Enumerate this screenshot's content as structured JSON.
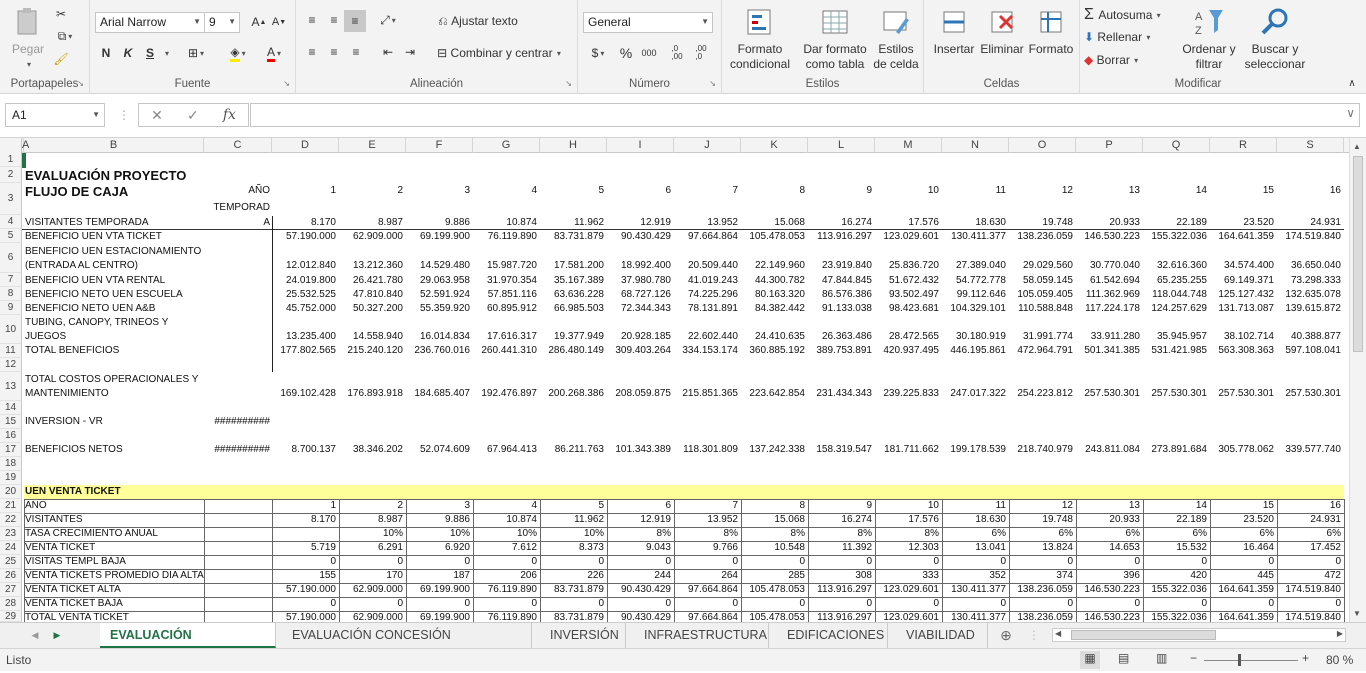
{
  "ribbon": {
    "portapapeles": {
      "label": "Portapapeles",
      "paste": "Pegar"
    },
    "fuente": {
      "label": "Fuente",
      "font": "Arial Narrow",
      "size": "9",
      "bold": "N",
      "italic": "K",
      "underline": "S"
    },
    "alineacion": {
      "label": "Alineación",
      "wrap": "Ajustar texto",
      "merge": "Combinar y centrar"
    },
    "numero": {
      "label": "Número",
      "format": "General",
      "currency": "$",
      "percent": "%",
      "thousands": "000",
      "inc_dec": ",0\n,00",
      "dec_dec": ",00\n,0"
    },
    "estilos": {
      "label": "Estilos",
      "cond": "Formato condicional",
      "table": "Dar formato como tabla",
      "cell": "Estilos de celda"
    },
    "celdas": {
      "label": "Celdas",
      "insert": "Insertar",
      "delete": "Eliminar",
      "format": "Formato"
    },
    "modificar": {
      "label": "Modificar",
      "autosum": "Autosuma",
      "fill": "Rellenar",
      "clear": "Borrar",
      "sort": "Ordenar y filtrar",
      "find": "Buscar y seleccionar"
    }
  },
  "formula_bar": {
    "namebox": "A1",
    "fx": "fx",
    "value": ""
  },
  "columns": [
    "A",
    "B",
    "C",
    "D",
    "E",
    "F",
    "G",
    "H",
    "I",
    "J",
    "K",
    "L",
    "M",
    "N",
    "O",
    "P",
    "Q",
    "R",
    "S"
  ],
  "rows": [
    "1",
    "2",
    "3",
    "4",
    "5",
    "6",
    "7",
    "8",
    "9",
    "10",
    "11",
    "12",
    "13",
    "14",
    "15",
    "16",
    "17",
    "18",
    "19",
    "20",
    "21",
    "22",
    "23",
    "24",
    "25",
    "26",
    "27",
    "28",
    "29"
  ],
  "cells": {
    "r2": {
      "b": "EVALUACIÓN PROYECTO"
    },
    "r3": {
      "b": "FLUJO DE CAJA",
      "c": "AÑO",
      "vals": [
        "1",
        "2",
        "3",
        "4",
        "5",
        "6",
        "7",
        "8",
        "9",
        "10",
        "11",
        "12",
        "13",
        "14",
        "15",
        "16"
      ]
    },
    "r3b": {
      "c": "TEMPORAD"
    },
    "r4": {
      "b": "VISITANTES TEMPORADA",
      "c": "A",
      "vals": [
        "8.170",
        "8.987",
        "9.886",
        "10.874",
        "11.962",
        "12.919",
        "13.952",
        "15.068",
        "16.274",
        "17.576",
        "18.630",
        "19.748",
        "20.933",
        "22.189",
        "23.520",
        "24.931"
      ]
    },
    "r5": {
      "b": "BENEFICIO UEN VTA TICKET",
      "vals": [
        "57.190.000",
        "62.909.000",
        "69.199.900",
        "76.119.890",
        "83.731.879",
        "90.430.429",
        "97.664.864",
        "105.478.053",
        "113.916.297",
        "123.029.601",
        "130.411.377",
        "138.236.059",
        "146.530.223",
        "155.322.036",
        "164.641.359",
        "174.519.840"
      ]
    },
    "r6a": {
      "b": "BENEFICIO UEN ESTACIONAMIENTO"
    },
    "r6": {
      "b": "(ENTRADA AL CENTRO)",
      "vals": [
        "12.012.840",
        "13.212.360",
        "14.529.480",
        "15.987.720",
        "17.581.200",
        "18.992.400",
        "20.509.440",
        "22.149.960",
        "23.919.840",
        "25.836.720",
        "27.389.040",
        "29.029.560",
        "30.770.040",
        "32.616.360",
        "34.574.400",
        "36.650.040"
      ]
    },
    "r7": {
      "b": "BENEFICIO UEN VTA RENTAL",
      "vals": [
        "24.019.800",
        "26.421.780",
        "29.063.958",
        "31.970.354",
        "35.167.389",
        "37.980.780",
        "41.019.243",
        "44.300.782",
        "47.844.845",
        "51.672.432",
        "54.772.778",
        "58.059.145",
        "61.542.694",
        "65.235.255",
        "69.149.371",
        "73.298.333"
      ]
    },
    "r8": {
      "b": "BENEFICIO NETO UEN ESCUELA",
      "vals": [
        "25.532.525",
        "47.810.840",
        "52.591.924",
        "57.851.116",
        "63.636.228",
        "68.727.126",
        "74.225.296",
        "80.163.320",
        "86.576.386",
        "93.502.497",
        "99.112.646",
        "105.059.405",
        "111.362.969",
        "118.044.748",
        "125.127.432",
        "132.635.078"
      ]
    },
    "r9": {
      "b": "BENEFICIO NETO UEN A&B",
      "vals": [
        "45.752.000",
        "50.327.200",
        "55.359.920",
        "60.895.912",
        "66.985.503",
        "72.344.343",
        "78.131.891",
        "84.382.442",
        "91.133.038",
        "98.423.681",
        "104.329.101",
        "110.588.848",
        "117.224.178",
        "124.257.629",
        "131.713.087",
        "139.615.872"
      ]
    },
    "r10a": {
      "b": "TUBING, CANOPY, TRINEOS Y"
    },
    "r10": {
      "b": "JUEGOS",
      "vals": [
        "13.235.400",
        "14.558.940",
        "16.014.834",
        "17.616.317",
        "19.377.949",
        "20.928.185",
        "22.602.440",
        "24.410.635",
        "26.363.486",
        "28.472.565",
        "30.180.919",
        "31.991.774",
        "33.911.280",
        "35.945.957",
        "38.102.714",
        "40.388.877"
      ]
    },
    "r11": {
      "b": "TOTAL BENEFICIOS",
      "vals": [
        "177.802.565",
        "215.240.120",
        "236.760.016",
        "260.441.310",
        "286.480.149",
        "309.403.264",
        "334.153.174",
        "360.885.192",
        "389.753.891",
        "420.937.495",
        "446.195.861",
        "472.964.791",
        "501.341.385",
        "531.421.985",
        "563.308.363",
        "597.108.041"
      ]
    },
    "r13a": {
      "b": "TOTAL COSTOS OPERACIONALES Y"
    },
    "r13": {
      "b": "MANTENIMIENTO",
      "vals": [
        "169.102.428",
        "176.893.918",
        "184.685.407",
        "192.476.897",
        "200.268.386",
        "208.059.875",
        "215.851.365",
        "223.642.854",
        "231.434.343",
        "239.225.833",
        "247.017.322",
        "254.223.812",
        "257.530.301",
        "257.530.301",
        "257.530.301",
        "257.530.301"
      ]
    },
    "r15": {
      "b": "INVERSION - VR",
      "c": "##########"
    },
    "r17": {
      "b": "BENEFICIOS NETOS",
      "c": "##########",
      "vals": [
        "8.700.137",
        "38.346.202",
        "52.074.609",
        "67.964.413",
        "86.211.763",
        "101.343.389",
        "118.301.809",
        "137.242.338",
        "158.319.547",
        "181.711.662",
        "199.178.539",
        "218.740.979",
        "243.811.084",
        "273.891.684",
        "305.778.062",
        "339.577.740"
      ]
    },
    "r20": {
      "b": "UEN VENTA TICKET"
    },
    "r21": {
      "b": "AÑO",
      "vals": [
        "1",
        "2",
        "3",
        "4",
        "5",
        "6",
        "7",
        "8",
        "9",
        "10",
        "11",
        "12",
        "13",
        "14",
        "15",
        "16"
      ]
    },
    "r22": {
      "b": "VISITANTES",
      "vals": [
        "8.170",
        "8.987",
        "9.886",
        "10.874",
        "11.962",
        "12.919",
        "13.952",
        "15.068",
        "16.274",
        "17.576",
        "18.630",
        "19.748",
        "20.933",
        "22.189",
        "23.520",
        "24.931"
      ]
    },
    "r23": {
      "b": "TASA CRECIMIENTO ANUAL",
      "vals": [
        "",
        "10%",
        "10%",
        "10%",
        "10%",
        "8%",
        "8%",
        "8%",
        "8%",
        "8%",
        "6%",
        "6%",
        "6%",
        "6%",
        "6%",
        "6%"
      ]
    },
    "r24": {
      "b": "VENTA TICKET",
      "vals": [
        "5.719",
        "6.291",
        "6.920",
        "7.612",
        "8.373",
        "9.043",
        "9.766",
        "10.548",
        "11.392",
        "12.303",
        "13.041",
        "13.824",
        "14.653",
        "15.532",
        "16.464",
        "17.452"
      ]
    },
    "r25": {
      "b": "VISITAS TEMPL BAJA",
      "vals": [
        "0",
        "0",
        "0",
        "0",
        "0",
        "0",
        "0",
        "0",
        "0",
        "0",
        "0",
        "0",
        "0",
        "0",
        "0",
        "0"
      ]
    },
    "r26": {
      "b": "VENTA TICKETS PROMEDIO DIA ALTA",
      "vals": [
        "155",
        "170",
        "187",
        "206",
        "226",
        "244",
        "264",
        "285",
        "308",
        "333",
        "352",
        "374",
        "396",
        "420",
        "445",
        "472"
      ]
    },
    "r27": {
      "b": "VENTA TICKET ALTA",
      "vals": [
        "57.190.000",
        "62.909.000",
        "69.199.900",
        "76.119.890",
        "83.731.879",
        "90.430.429",
        "97.664.864",
        "105.478.053",
        "113.916.297",
        "123.029.601",
        "130.411.377",
        "138.236.059",
        "146.530.223",
        "155.322.036",
        "164.641.359",
        "174.519.840"
      ]
    },
    "r28": {
      "b": "VENTA TICKET BAJA",
      "vals": [
        "0",
        "0",
        "0",
        "0",
        "0",
        "0",
        "0",
        "0",
        "0",
        "0",
        "0",
        "0",
        "0",
        "0",
        "0",
        "0"
      ]
    },
    "r29": {
      "b": "TOTAL VENTA TICKET",
      "vals": [
        "57.190.000",
        "62.909.000",
        "69.199.900",
        "76.119.890",
        "83.731.879",
        "90.430.429",
        "97.664.864",
        "105.478.053",
        "113.916.297",
        "123.029.601",
        "130.411.377",
        "138.236.059",
        "146.530.223",
        "155.322.036",
        "164.641.359",
        "174.519.840"
      ]
    }
  },
  "tabs": [
    "EVALUACIÓN PROYECTO",
    "EVALUACIÓN CONCESIÓN OPERACIÓN",
    "INVERSIÓN",
    "INFRAESTRUCTURA",
    "EDIFICACIONES",
    "VIABILIDAD ..."
  ],
  "status": {
    "mode": "Listo",
    "zoom": "80 %"
  },
  "colors": {
    "accent": "#217346",
    "highlight": "#ffff99"
  }
}
